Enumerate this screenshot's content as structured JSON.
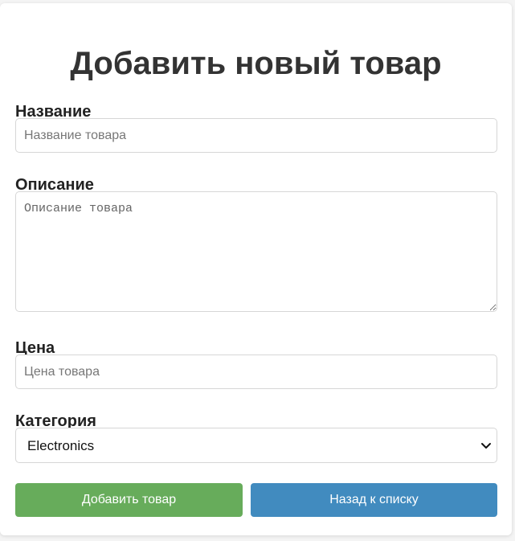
{
  "page": {
    "title": "Добавить новый товар"
  },
  "form": {
    "name": {
      "label": "Название",
      "placeholder": "Название товара",
      "value": ""
    },
    "description": {
      "label": "Описание",
      "placeholder": "Описание товара",
      "value": ""
    },
    "price": {
      "label": "Цена",
      "placeholder": "Цена товара",
      "value": ""
    },
    "category": {
      "label": "Категория",
      "selected": "Electronics"
    }
  },
  "buttons": {
    "add_label": "Добавить товар",
    "back_label": "Назад к списку"
  },
  "colors": {
    "add_button": "#67ac5b",
    "back_button": "#418bbf"
  },
  "icons": {
    "select": "chevron-down-icon"
  }
}
